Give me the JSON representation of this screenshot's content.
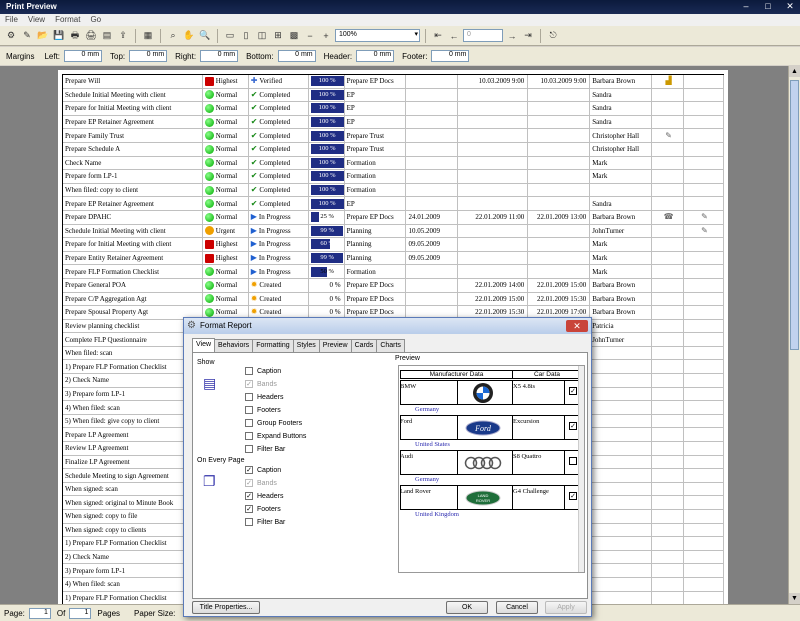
{
  "window": {
    "title": "Print Preview"
  },
  "menu": [
    "File",
    "View",
    "Format",
    "Go"
  ],
  "toolbar": {
    "zoom": "100%",
    "page_input": "0"
  },
  "margins": {
    "label": "Margins",
    "fields": [
      {
        "label": "Left:",
        "value": "0 mm"
      },
      {
        "label": "Top:",
        "value": "0 mm"
      },
      {
        "label": "Right:",
        "value": "0 mm"
      },
      {
        "label": "Bottom:",
        "value": "0 mm"
      },
      {
        "label": "Header:",
        "value": "0 mm"
      },
      {
        "label": "Footer:",
        "value": "0 mm"
      }
    ]
  },
  "report_rows": [
    {
      "task": "Prepare Will",
      "priority": "Highest",
      "pri": "red",
      "status": "Verified",
      "st": "verified",
      "pct": "100 %",
      "fill": 1,
      "group": "Prepare EP Docs",
      "d1": "",
      "d2": "10.03.2009 9:00",
      "d3": "10.03.2009 9:00",
      "owner": "Barbara Brown",
      "extra": "chart"
    },
    {
      "task": "Schedule Initial Meeting with client",
      "priority": "Normal",
      "pri": "green",
      "status": "Completed",
      "st": "check",
      "pct": "100 %",
      "fill": 1,
      "group": "EP",
      "d1": "",
      "d2": "",
      "d3": "",
      "owner": "Sandra",
      "extra": ""
    },
    {
      "task": "Prepare for Initial Meeting with client",
      "priority": "Normal",
      "pri": "green",
      "status": "Completed",
      "st": "check",
      "pct": "100 %",
      "fill": 1,
      "group": "EP",
      "d1": "",
      "d2": "",
      "d3": "",
      "owner": "Sandra",
      "extra": ""
    },
    {
      "task": "Prepare EP Retainer Agreement",
      "priority": "Normal",
      "pri": "green",
      "status": "Completed",
      "st": "check",
      "pct": "100 %",
      "fill": 1,
      "group": "EP",
      "d1": "",
      "d2": "",
      "d3": "",
      "owner": "Sandra",
      "extra": ""
    },
    {
      "task": "Prepare Family Trust",
      "priority": "Normal",
      "pri": "green",
      "status": "Completed",
      "st": "check",
      "pct": "100 %",
      "fill": 1,
      "group": "Prepare Trust",
      "d1": "",
      "d2": "",
      "d3": "",
      "owner": "Christopher Hall",
      "extra": "doc"
    },
    {
      "task": "Prepare Schedule A",
      "priority": "Normal",
      "pri": "green",
      "status": "Completed",
      "st": "check",
      "pct": "100 %",
      "fill": 1,
      "group": "Prepare Trust",
      "d1": "",
      "d2": "",
      "d3": "",
      "owner": "Christopher Hall",
      "extra": ""
    },
    {
      "task": "Check Name",
      "priority": "Normal",
      "pri": "green",
      "status": "Completed",
      "st": "check",
      "pct": "100 %",
      "fill": 1,
      "group": "Formation",
      "d1": "",
      "d2": "",
      "d3": "",
      "owner": "Mark",
      "extra": ""
    },
    {
      "task": "Prepare form LP-1",
      "priority": "Normal",
      "pri": "green",
      "status": "Completed",
      "st": "check",
      "pct": "100 %",
      "fill": 1,
      "group": "Formation",
      "d1": "",
      "d2": "",
      "d3": "",
      "owner": "Mark",
      "extra": ""
    },
    {
      "task": "When filed:  copy to client",
      "priority": "Normal",
      "pri": "green",
      "status": "Completed",
      "st": "check",
      "pct": "100 %",
      "fill": 1,
      "group": "Formation",
      "d1": "",
      "d2": "",
      "d3": "",
      "owner": "",
      "extra": ""
    },
    {
      "task": "Prepare EP Retainer Agreement",
      "priority": "Normal",
      "pri": "green",
      "status": "Completed",
      "st": "check",
      "pct": "100 %",
      "fill": 1,
      "group": "EP",
      "d1": "",
      "d2": "",
      "d3": "",
      "owner": "Sandra",
      "extra": ""
    },
    {
      "task": "Prepare DPAHC",
      "priority": "Normal",
      "pri": "green",
      "status": "In Progress",
      "st": "prog",
      "pct": "25 %",
      "fill": 0.25,
      "group": "Prepare EP Docs",
      "d1": "24.01.2009",
      "d2": "22.01.2009 11:00",
      "d3": "22.01.2009 13:00",
      "owner": "Barbara Brown",
      "extra": "phone"
    },
    {
      "task": "Schedule Initial Meeting with client",
      "priority": "Urgent",
      "pri": "warn",
      "status": "In Progress",
      "st": "prog",
      "pct": "99 %",
      "fill": 0.99,
      "group": "Planning",
      "d1": "10.05.2009",
      "d2": "",
      "d3": "",
      "owner": "JohnTurner",
      "extra": "doc"
    },
    {
      "task": "Prepare for Initial Meeting with client",
      "priority": "Highest",
      "pri": "red",
      "status": "In Progress",
      "st": "prog",
      "pct": "60 %",
      "fill": 0.6,
      "group": "Planning",
      "d1": "09.05.2009",
      "d2": "",
      "d3": "",
      "owner": "Mark",
      "extra": ""
    },
    {
      "task": "Prepare Entity Retainer Agreement",
      "priority": "Highest",
      "pri": "red",
      "status": "In Progress",
      "st": "prog",
      "pct": "99 %",
      "fill": 0.99,
      "group": "Planning",
      "d1": "09.05.2009",
      "d2": "",
      "d3": "",
      "owner": "Mark",
      "extra": ""
    },
    {
      "task": "Prepare FLP Formation Checklist",
      "priority": "Normal",
      "pri": "green",
      "status": "In Progress",
      "st": "prog",
      "pct": "50 %",
      "fill": 0.5,
      "group": "Formation",
      "d1": "",
      "d2": "",
      "d3": "",
      "owner": "Mark",
      "extra": ""
    },
    {
      "task": "Prepare General POA",
      "priority": "Normal",
      "pri": "green",
      "status": "Created",
      "st": "star",
      "pct": "0 %",
      "fill": 0,
      "group": "Prepare EP Docs",
      "d1": "",
      "d2": "22.01.2009 14:00",
      "d3": "22.01.2009 15:00",
      "owner": "Barbara Brown",
      "extra": ""
    },
    {
      "task": "Prepare C/P Aggregation Agt",
      "priority": "Normal",
      "pri": "green",
      "status": "Created",
      "st": "star",
      "pct": "0 %",
      "fill": 0,
      "group": "Prepare EP Docs",
      "d1": "",
      "d2": "22.01.2009 15:00",
      "d3": "22.01.2009 15:30",
      "owner": "Barbara Brown",
      "extra": ""
    },
    {
      "task": "Prepare Spousal Property Agt",
      "priority": "Normal",
      "pri": "green",
      "status": "Created",
      "st": "star",
      "pct": "0 %",
      "fill": 0,
      "group": "Prepare EP Docs",
      "d1": "",
      "d2": "22.01.2009 15:30",
      "d3": "22.01.2009 17:00",
      "owner": "Barbara Brown",
      "extra": ""
    },
    {
      "task": "Review planning checklist",
      "priority": "",
      "pri": "",
      "status": "",
      "st": "",
      "pct": "",
      "fill": -1,
      "group": "",
      "d1": "",
      "d2": "",
      "d3": "",
      "owner": "Patricia",
      "extra": ""
    },
    {
      "task": "Complete FLP Questionnaire",
      "priority": "",
      "pri": "",
      "status": "",
      "st": "",
      "pct": "",
      "fill": -1,
      "group": "",
      "d1": "",
      "d2": "",
      "d3": "",
      "owner": "JohnTurner",
      "extra": ""
    },
    {
      "task": "When filed:  scan",
      "priority": "",
      "pri": "",
      "status": "",
      "st": "",
      "pct": "",
      "fill": -1,
      "group": "",
      "d1": "",
      "d2": "",
      "d3": "",
      "owner": "",
      "extra": ""
    },
    {
      "task": "1) Prepare FLP Formation Checklist",
      "priority": "",
      "pri": "",
      "status": "",
      "st": "",
      "pct": "",
      "fill": -1,
      "group": "",
      "d1": "",
      "d2": "",
      "d3": "",
      "owner": "",
      "extra": ""
    },
    {
      "task": "2) Check Name",
      "priority": "",
      "pri": "",
      "status": "",
      "st": "",
      "pct": "",
      "fill": -1,
      "group": "",
      "d1": "",
      "d2": "",
      "d3": "",
      "owner": "",
      "extra": ""
    },
    {
      "task": "3) Prepare form LP-1",
      "priority": "",
      "pri": "",
      "status": "",
      "st": "",
      "pct": "",
      "fill": -1,
      "group": "",
      "d1": "",
      "d2": "",
      "d3": "",
      "owner": "",
      "extra": ""
    },
    {
      "task": "4) When filed:  scan",
      "priority": "",
      "pri": "",
      "status": "",
      "st": "",
      "pct": "",
      "fill": -1,
      "group": "",
      "d1": "",
      "d2": "",
      "d3": "",
      "owner": "",
      "extra": ""
    },
    {
      "task": "5) When filed: give copy to client",
      "priority": "",
      "pri": "",
      "status": "",
      "st": "",
      "pct": "",
      "fill": -1,
      "group": "",
      "d1": "",
      "d2": "",
      "d3": "",
      "owner": "",
      "extra": ""
    },
    {
      "task": "Prepare LP Agreement",
      "priority": "",
      "pri": "",
      "status": "",
      "st": "",
      "pct": "",
      "fill": -1,
      "group": "",
      "d1": "",
      "d2": "",
      "d3": "",
      "owner": "",
      "extra": ""
    },
    {
      "task": "Review LP Agreement",
      "priority": "",
      "pri": "",
      "status": "",
      "st": "",
      "pct": "",
      "fill": -1,
      "group": "",
      "d1": "",
      "d2": "",
      "d3": "",
      "owner": "",
      "extra": ""
    },
    {
      "task": "Finalize LP Agreement",
      "priority": "",
      "pri": "",
      "status": "",
      "st": "",
      "pct": "",
      "fill": -1,
      "group": "",
      "d1": "",
      "d2": "",
      "d3": "",
      "owner": "",
      "extra": ""
    },
    {
      "task": "Schedule Meeting to sign Agreement",
      "priority": "",
      "pri": "",
      "status": "",
      "st": "",
      "pct": "",
      "fill": -1,
      "group": "",
      "d1": "",
      "d2": "",
      "d3": "",
      "owner": "",
      "extra": ""
    },
    {
      "task": "When signed:  scan",
      "priority": "",
      "pri": "",
      "status": "",
      "st": "",
      "pct": "",
      "fill": -1,
      "group": "",
      "d1": "",
      "d2": "",
      "d3": "",
      "owner": "",
      "extra": ""
    },
    {
      "task": "When signed:  original to Minute Book",
      "priority": "",
      "pri": "",
      "status": "",
      "st": "",
      "pct": "",
      "fill": -1,
      "group": "",
      "d1": "",
      "d2": "",
      "d3": "",
      "owner": "",
      "extra": ""
    },
    {
      "task": "When signed:  copy to file",
      "priority": "",
      "pri": "",
      "status": "",
      "st": "",
      "pct": "",
      "fill": -1,
      "group": "",
      "d1": "",
      "d2": "",
      "d3": "",
      "owner": "",
      "extra": ""
    },
    {
      "task": "When signed:  copy to clients",
      "priority": "",
      "pri": "",
      "status": "",
      "st": "",
      "pct": "",
      "fill": -1,
      "group": "",
      "d1": "",
      "d2": "",
      "d3": "",
      "owner": "",
      "extra": ""
    },
    {
      "task": "1) Prepare FLP Formation Checklist",
      "priority": "",
      "pri": "",
      "status": "",
      "st": "",
      "pct": "",
      "fill": -1,
      "group": "",
      "d1": "",
      "d2": "",
      "d3": "",
      "owner": "",
      "extra": ""
    },
    {
      "task": "2) Check Name",
      "priority": "",
      "pri": "",
      "status": "",
      "st": "",
      "pct": "",
      "fill": -1,
      "group": "",
      "d1": "",
      "d2": "",
      "d3": "",
      "owner": "",
      "extra": ""
    },
    {
      "task": "3) Prepare form LP-1",
      "priority": "",
      "pri": "",
      "status": "",
      "st": "",
      "pct": "",
      "fill": -1,
      "group": "",
      "d1": "",
      "d2": "",
      "d3": "",
      "owner": "",
      "extra": ""
    },
    {
      "task": "4) When filed:  scan",
      "priority": "",
      "pri": "",
      "status": "",
      "st": "",
      "pct": "",
      "fill": -1,
      "group": "",
      "d1": "",
      "d2": "",
      "d3": "",
      "owner": "",
      "extra": ""
    },
    {
      "task": "1) Prepare FLP Formation Checklist",
      "priority": "",
      "pri": "",
      "status": "",
      "st": "",
      "pct": "",
      "fill": -1,
      "group": "",
      "d1": "",
      "d2": "",
      "d3": "",
      "owner": "",
      "extra": ""
    }
  ],
  "statusbar": {
    "page_label": "Page:",
    "page": "1",
    "of_label": "Of",
    "of": "1",
    "pages_label": "Pages",
    "paper_label": "Paper Size:"
  },
  "dialog": {
    "title": "Format Report",
    "tabs": [
      "View",
      "Behaviors",
      "Formatting",
      "Styles",
      "Preview",
      "Cards",
      "Charts"
    ],
    "show_label": "Show",
    "show_items": [
      {
        "label": "Caption",
        "checked": false,
        "disabled": false
      },
      {
        "label": "Bands",
        "checked": true,
        "disabled": true
      },
      {
        "label": "Headers",
        "checked": false,
        "disabled": false
      },
      {
        "label": "Footers",
        "checked": false,
        "disabled": false
      },
      {
        "label": "Group Footers",
        "checked": false,
        "disabled": false
      },
      {
        "label": "Expand Buttons",
        "checked": false,
        "disabled": false
      },
      {
        "label": "Filter Bar",
        "checked": false,
        "disabled": false
      }
    ],
    "every_page_label": "On Every Page",
    "every_page_items": [
      {
        "label": "Caption",
        "checked": true,
        "disabled": false
      },
      {
        "label": "Bands",
        "checked": true,
        "disabled": true
      },
      {
        "label": "Headers",
        "checked": true,
        "disabled": false
      },
      {
        "label": "Footers",
        "checked": true,
        "disabled": false
      },
      {
        "label": "Filter Bar",
        "checked": false,
        "disabled": false
      }
    ],
    "preview_label": "Preview",
    "preview": {
      "col1": "Manufacturer Data",
      "col2": "Car Data",
      "rows": [
        {
          "make": "BMW",
          "car": "X5 4.8is",
          "country": "Germany",
          "checked": true,
          "logo": "bmw-logo"
        },
        {
          "make": "Ford",
          "car": "Excursion",
          "country": "United States",
          "checked": true,
          "logo": "ford-logo"
        },
        {
          "make": "Audi",
          "car": "S8 Quattro",
          "country": "Germany",
          "checked": false,
          "logo": "audi-logo"
        },
        {
          "make": "Land Rover",
          "car": "G4 Challenge",
          "country": "United Kingdom",
          "checked": true,
          "logo": "land-rover-logo"
        }
      ]
    },
    "title_props_btn": "Title Properties...",
    "ok_btn": "OK",
    "cancel_btn": "Cancel",
    "apply_btn": "Apply"
  }
}
